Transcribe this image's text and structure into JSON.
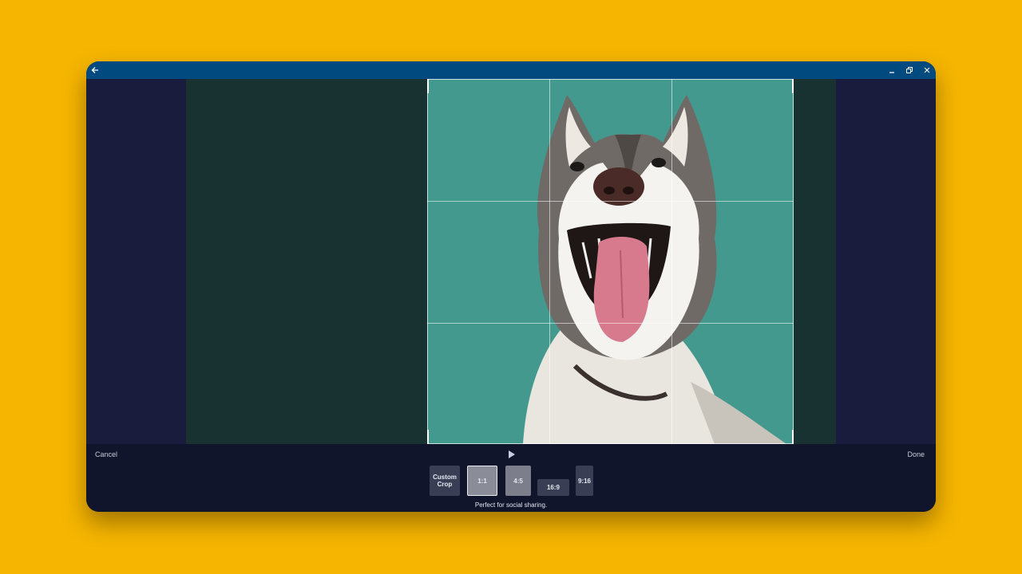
{
  "window": {
    "back_icon": "arrow-left-icon",
    "minimize_icon": "minimize-icon",
    "restore_icon": "restore-icon",
    "close_icon": "close-icon"
  },
  "crop_tool": {
    "cancel_label": "Cancel",
    "done_label": "Done",
    "play_icon": "play-icon",
    "ratios": [
      {
        "label": "Custom Crop",
        "selected": false
      },
      {
        "label": "1:1",
        "selected": true
      },
      {
        "label": "4:5",
        "selected": false
      },
      {
        "label": "16:9",
        "selected": false
      },
      {
        "label": "9:16",
        "selected": false
      }
    ],
    "caption": "Perfect for social sharing."
  },
  "colors": {
    "page_background": "#F6B500",
    "titlebar": "#004A7F",
    "crop_background": "#44998F",
    "panel": "#11152B"
  }
}
